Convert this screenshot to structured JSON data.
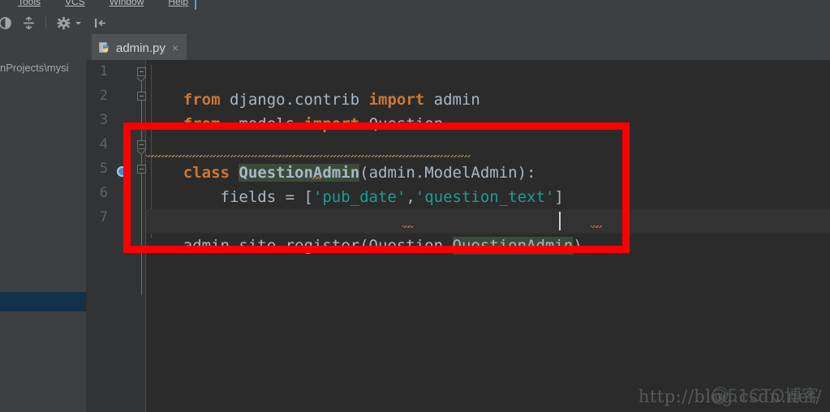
{
  "window": {
    "menu_items": [
      "Tools",
      "VCS",
      "Window",
      "Help"
    ]
  },
  "toolbar": {
    "icons": [
      {
        "name": "history-icon",
        "glyph": "◑"
      },
      {
        "name": "split-vertically-icon",
        "glyph": "÷"
      },
      {
        "name": "settings-gear-icon",
        "glyph": "✱"
      },
      {
        "name": "gear-dropdown-arrow-icon",
        "glyph": "▾"
      },
      {
        "name": "hide-panel-icon",
        "glyph": "|←"
      }
    ]
  },
  "project_panel": {
    "path_label": "nProjects\\mysi",
    "selected_item_label": ""
  },
  "tabs": [
    {
      "label": "admin.py",
      "icon": "python-file-icon",
      "close_label": "×",
      "active": true
    }
  ],
  "gutter": {
    "line_numbers": [
      "1",
      "2",
      "3",
      "4",
      "5",
      "6",
      "7"
    ],
    "breakpoint_marker_line": "5"
  },
  "editor": {
    "lines": [
      {
        "number": "1",
        "tokens": [
          {
            "t": "from",
            "c": "kw"
          },
          {
            "t": " django.contrib ",
            "c": "ident"
          },
          {
            "t": "import",
            "c": "kw"
          },
          {
            "t": " admin",
            "c": "ident"
          }
        ]
      },
      {
        "number": "2",
        "tokens": [
          {
            "t": "from",
            "c": "kw"
          },
          {
            "t": " .models ",
            "c": "ident"
          },
          {
            "t": "import",
            "c": "kw"
          },
          {
            "t": " Question",
            "c": "ident"
          }
        ]
      },
      {
        "number": "3",
        "tokens": []
      },
      {
        "number": "4",
        "tokens": [
          {
            "t": "class",
            "c": "kw"
          },
          {
            "t": " ",
            "c": "ident"
          },
          {
            "t": "QuestionAdmin",
            "c": "cls hl-caret"
          },
          {
            "t": "(admin.ModelAdmin):",
            "c": "ident"
          }
        ]
      },
      {
        "number": "5",
        "tokens": [
          {
            "t": "    fields = [",
            "c": "ident"
          },
          {
            "t": "'pub_date'",
            "c": "strq"
          },
          {
            "t": ",",
            "c": "ident"
          },
          {
            "t": "'question_text'",
            "c": "strq"
          },
          {
            "t": "]",
            "c": "ident"
          }
        ]
      },
      {
        "number": "6",
        "tokens": []
      },
      {
        "number": "7",
        "tokens": [
          {
            "t": "admin.site.register(Question",
            "c": "ident"
          },
          {
            "t": ",",
            "c": "ident"
          },
          {
            "t": "QuestionAdmin",
            "c": "ident hl-caret"
          },
          {
            "t": ")",
            "c": "ident"
          }
        ]
      }
    ],
    "plain_text": "from django.contrib import admin\nfrom .models import Question\n\nclass QuestionAdmin(admin.ModelAdmin):\n    fields = ['pub_date','question_text']\n\nadmin.site.register(Question,QuestionAdmin)"
  },
  "annotation": {
    "shape": "rectangle",
    "color": "#fb0000",
    "covers_lines": [
      "3",
      "4",
      "5",
      "6",
      "7"
    ]
  },
  "watermark": {
    "url_text": "http://blog.csdn.net/",
    "overlay_text": "@51CTO博客",
    "color": "#565a5c"
  },
  "colors": {
    "editor_background": "#2b2b2b",
    "gutter_background": "#313335",
    "panel_background": "#3c4043",
    "tab_active_background": "#4e5254",
    "keyword": "#cc7832",
    "identifier": "#a9b7c6",
    "string": "#1c9e8f",
    "caret_highlight": "#3b4b3b",
    "current_line": "#323232",
    "selection_blue": "#12314a",
    "annotation_red": "#fb0000"
  }
}
